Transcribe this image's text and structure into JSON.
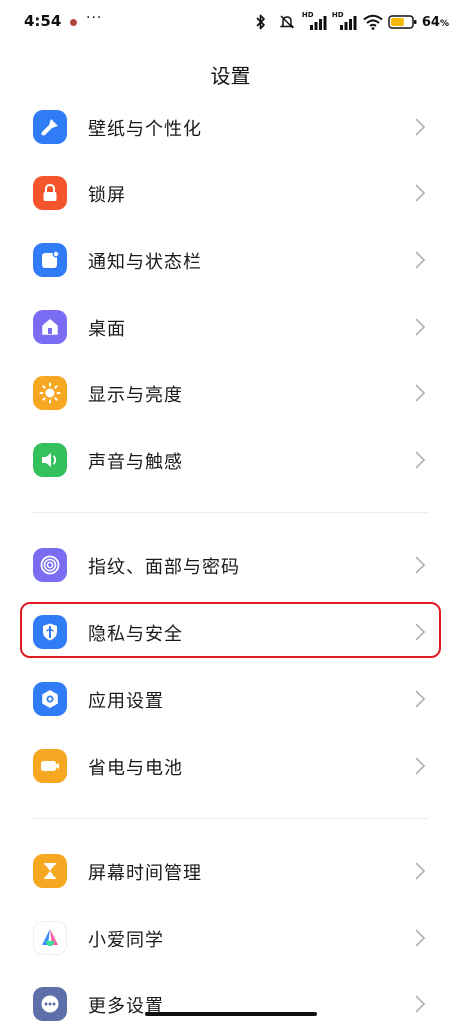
{
  "status_bar": {
    "time": "4:54",
    "more": "···",
    "battery_pct": "64",
    "battery_unit": "%",
    "hd1": "HD",
    "hd2": "HD",
    "battery_level": 0.64,
    "battery_color": "#f5b800"
  },
  "header": {
    "title": "设置"
  },
  "settings": {
    "items": [
      {
        "label": "壁纸与个性化",
        "icon": "paintbrush-icon",
        "color": "#2f7cf6"
      },
      {
        "label": "锁屏",
        "icon": "lock-icon",
        "color": "#f4552b"
      },
      {
        "label": "通知与状态栏",
        "icon": "notification-icon",
        "color": "#2f7cf6"
      },
      {
        "label": "桌面",
        "icon": "home-icon",
        "color": "#7a6cf3"
      },
      {
        "label": "显示与亮度",
        "icon": "sun-icon",
        "color": "#f7a823"
      },
      {
        "label": "声音与触感",
        "icon": "speaker-icon",
        "color": "#34c05a"
      },
      {
        "label": "指纹、面部与密码",
        "icon": "fingerprint-icon",
        "color": "#7a6cf3"
      },
      {
        "label": "隐私与安全",
        "icon": "shield-icon",
        "color": "#2f7cf6"
      },
      {
        "label": "应用设置",
        "icon": "app-settings-icon",
        "color": "#2f7cf6"
      },
      {
        "label": "省电与电池",
        "icon": "battery-icon",
        "color": "#f7a823"
      },
      {
        "label": "屏幕时间管理",
        "icon": "hourglass-icon",
        "color": "#f7a823"
      },
      {
        "label": "小爱同学",
        "icon": "xiaoai-icon",
        "color": "#ffffff"
      },
      {
        "label": "更多设置",
        "icon": "more-icon",
        "color": "#5e6ea8"
      }
    ]
  },
  "highlight_color": "#e01b22"
}
